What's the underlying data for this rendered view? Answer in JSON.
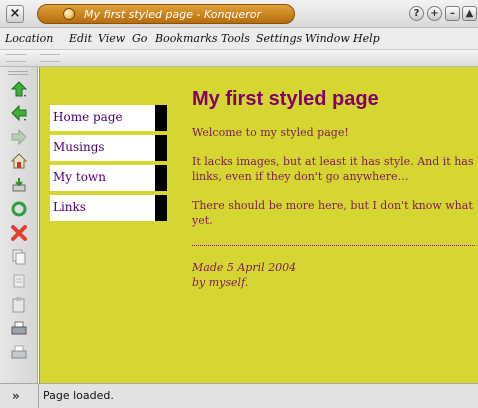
{
  "window": {
    "title": "My first styled page - Konqueror",
    "close_glyph": "×",
    "buttons": [
      "?",
      "+",
      "–",
      "▲"
    ]
  },
  "menu": {
    "items": [
      {
        "label": "Location"
      },
      {
        "label": "Edit"
      },
      {
        "label": "View"
      },
      {
        "label": "Go"
      },
      {
        "label": "Bookmarks"
      },
      {
        "label": "Tools"
      },
      {
        "label": "Settings"
      },
      {
        "label": "Window"
      },
      {
        "label": "Help"
      }
    ]
  },
  "toolbar": {
    "icons": [
      "up-arrow-icon",
      "back-arrow-icon",
      "forward-arrow-icon",
      "home-icon",
      "save-icon",
      "reload-icon",
      "stop-icon",
      "copy-icon",
      "cut-icon",
      "paste-icon",
      "print-icon",
      "print-preview-icon"
    ]
  },
  "page": {
    "nav": [
      {
        "label": "Home page"
      },
      {
        "label": "Musings"
      },
      {
        "label": "My town"
      },
      {
        "label": "Links"
      }
    ],
    "heading": "My first styled page",
    "paragraphs": [
      "Welcome to my styled page!",
      "It lacks images, but at least it has style. And it has links, even if they don't go anywhere…",
      "There should be more here, but I don't know what yet."
    ],
    "footer": {
      "line1": "Made 5 April 2004",
      "line2": "by myself."
    },
    "colors": {
      "background": "#d6d632",
      "heading": "#85006a",
      "text": "#7d1a52",
      "nav_bg": "#ffffff",
      "nav_border": "#000000"
    }
  },
  "status": {
    "text": "Page loaded.",
    "chevron": "»"
  }
}
